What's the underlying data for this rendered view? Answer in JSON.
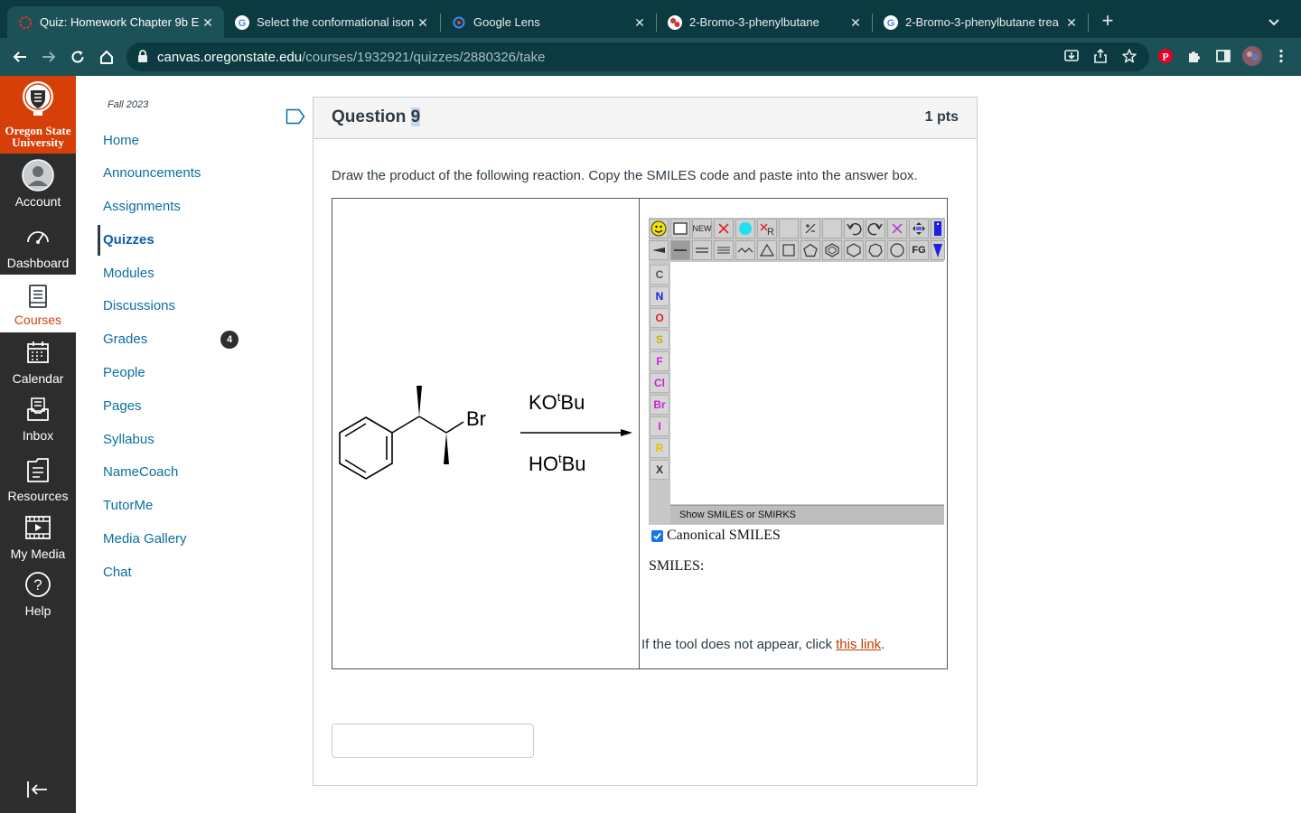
{
  "browser": {
    "tabs": [
      {
        "title": "Quiz: Homework Chapter 9b E",
        "favicon": "canvas-icon",
        "active": true
      },
      {
        "title": "Select the conformational ison",
        "favicon": "google-icon",
        "active": false
      },
      {
        "title": "Google Lens",
        "favicon": "google-lens-icon",
        "active": false
      },
      {
        "title": "2-Bromo-3-phenylbutane",
        "favicon": "chemistry-icon",
        "active": false
      },
      {
        "title": "2-Bromo-3-phenylbutane trea",
        "favicon": "google-icon",
        "active": false
      }
    ],
    "url_host": "canvas.oregonstate.edu",
    "url_path": "/courses/1932921/quizzes/2880326/take"
  },
  "global_nav": {
    "logo_line1": "Oregon State",
    "logo_line2": "University",
    "items": [
      {
        "label": "Account",
        "icon": "account-icon"
      },
      {
        "label": "Dashboard",
        "icon": "dashboard-icon"
      },
      {
        "label": "Courses",
        "icon": "courses-icon",
        "active": true
      },
      {
        "label": "Calendar",
        "icon": "calendar-icon"
      },
      {
        "label": "Inbox",
        "icon": "inbox-icon"
      },
      {
        "label": "Resources",
        "icon": "resources-icon"
      },
      {
        "label": "My Media",
        "icon": "my-media-icon"
      },
      {
        "label": "Help",
        "icon": "help-icon"
      }
    ]
  },
  "course_nav": {
    "term": "Fall 2023",
    "items": [
      "Home",
      "Announcements",
      "Assignments",
      "Quizzes",
      "Modules",
      "Discussions",
      "Grades",
      "People",
      "Pages",
      "Syllabus",
      "NameCoach",
      "TutorMe",
      "Media Gallery",
      "Chat"
    ],
    "active": "Quizzes",
    "grades_badge": "4"
  },
  "question": {
    "title_prefix": "Question ",
    "number": "9",
    "points": "1 pts",
    "prompt": "Draw the product of the following reaction.  Copy the SMILES code and paste into the answer box.",
    "reaction": {
      "substituent_label": "Br",
      "reagent_top_prefix": "KO",
      "reagent_top_sup": "t",
      "reagent_top_suffix": "Bu",
      "reagent_bottom_prefix": "HO",
      "reagent_bottom_sup": "t",
      "reagent_bottom_suffix": "Bu"
    },
    "editor": {
      "new_label": "NEW",
      "fg_label": "FG",
      "elements": [
        "C",
        "N",
        "O",
        "S",
        "F",
        "Cl",
        "Br",
        "I",
        "R",
        "X"
      ],
      "element_colors": [
        "#555555",
        "#2020e0",
        "#e02020",
        "#b8b800",
        "#d020d0",
        "#d020d0",
        "#d020d0",
        "#d020d0",
        "#e0c000",
        "#333333"
      ],
      "show_smiles_label": "Show SMILES or SMIRKS",
      "canonical_label": "Canonical SMILES",
      "canonical_checked": true,
      "smiles_label": "SMILES:",
      "smiles_value": ""
    },
    "fallback_text": "If the tool does not appear, click ",
    "fallback_link": "this link",
    "fallback_end": ".",
    "answer_value": ""
  },
  "colors": {
    "browser_dark": "#0b3b40",
    "browser_toolbar": "#1c5157",
    "osu_orange": "#d73f09",
    "canvas_link": "#0b6fa0",
    "nav_dark": "#2d2d2d"
  }
}
